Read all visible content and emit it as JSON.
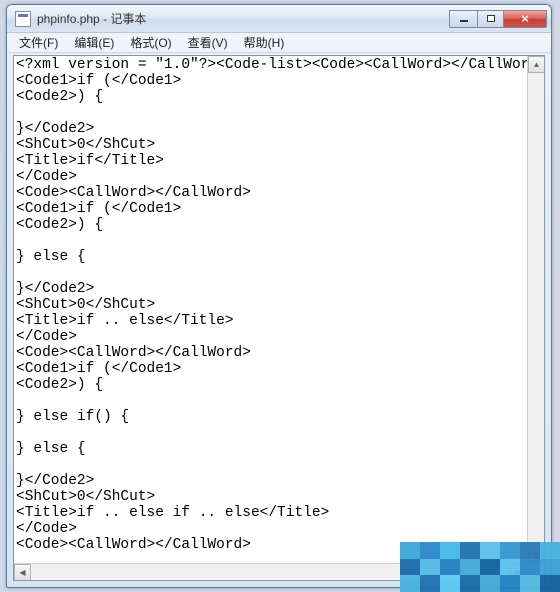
{
  "window": {
    "title": "phpinfo.php - 记事本"
  },
  "menu": {
    "file": "文件(F)",
    "edit": "编辑(E)",
    "format": "格式(O)",
    "view": "查看(V)",
    "help": "帮助(H)"
  },
  "editor": {
    "content": "<?xml version = \"1.0\"?><Code-list><Code><CallWord></CallWord>\n<Code1>if (</Code1>\n<Code2>) {\n\n}</Code2>\n<ShCut>0</ShCut>\n<Title>if</Title>\n</Code>\n<Code><CallWord></CallWord>\n<Code1>if (</Code1>\n<Code2>) {\n\n} else {\n\n}</Code2>\n<ShCut>0</ShCut>\n<Title>if .. else</Title>\n</Code>\n<Code><CallWord></CallWord>\n<Code1>if (</Code1>\n<Code2>) {\n\n} else if() {\n\n} else {\n\n}</Code2>\n<ShCut>0</ShCut>\n<Title>if .. else if .. else</Title>\n</Code>\n<Code><CallWord></CallWord>"
  }
}
